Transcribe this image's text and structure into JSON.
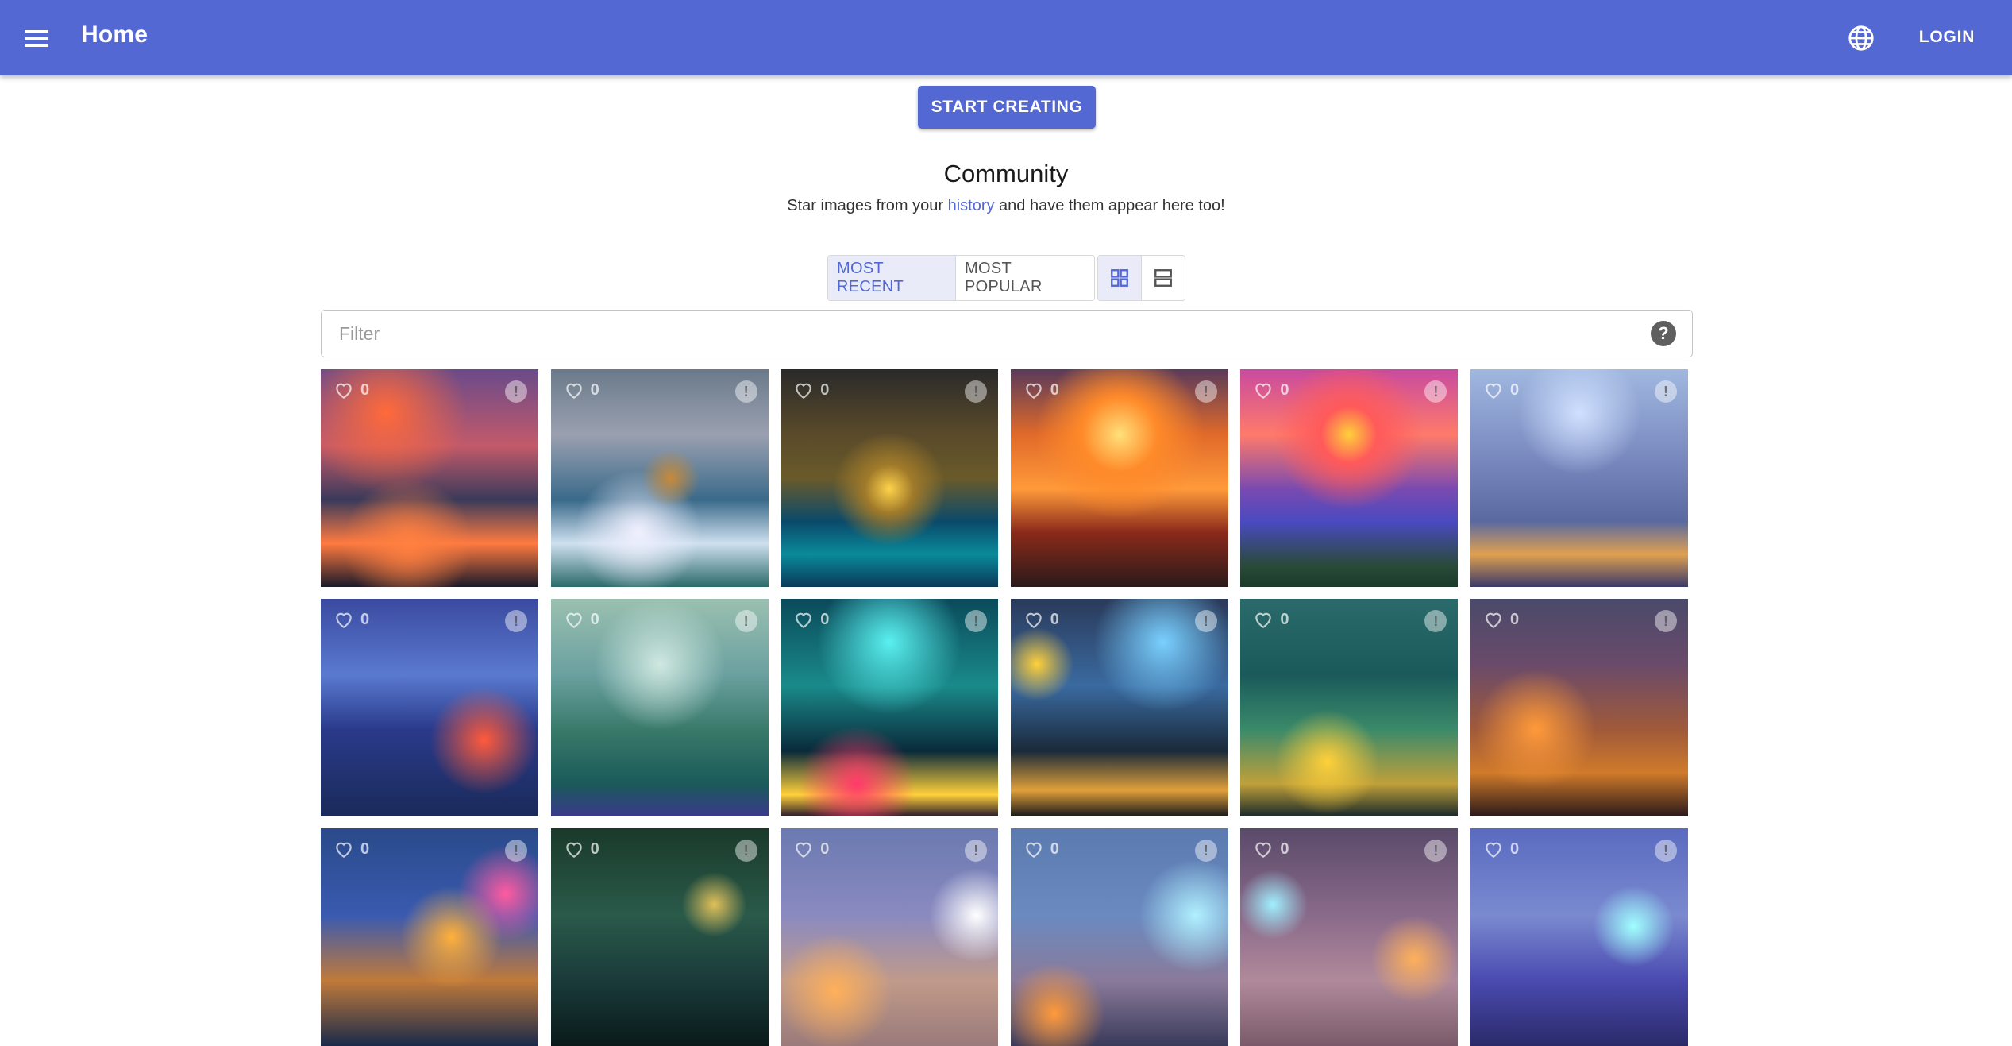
{
  "appbar": {
    "menu_icon": "hamburger-menu-icon",
    "title": "Home",
    "language_icon": "globe-icon",
    "login_label": "LOGIN"
  },
  "hero": {
    "start_label": "START CREATING"
  },
  "community": {
    "title": "Community",
    "subtitle_before": "Star images from your ",
    "subtitle_link": "history",
    "subtitle_after": " and have them appear here too!"
  },
  "sort": {
    "options": [
      "MOST RECENT",
      "MOST POPULAR"
    ],
    "selected": "MOST RECENT"
  },
  "view": {
    "grid_icon": "grid-view-icon",
    "list_icon": "list-view-icon",
    "selected": "grid"
  },
  "filter": {
    "placeholder": "Filter",
    "value": "",
    "help_icon": "help-icon",
    "help_label": "?"
  },
  "tiles": [
    {
      "likes": "0"
    },
    {
      "likes": "0"
    },
    {
      "likes": "0"
    },
    {
      "likes": "0"
    },
    {
      "likes": "0"
    },
    {
      "likes": "0"
    },
    {
      "likes": "0"
    },
    {
      "likes": "0"
    },
    {
      "likes": "0"
    },
    {
      "likes": "0"
    },
    {
      "likes": "0"
    },
    {
      "likes": "0"
    },
    {
      "likes": "0"
    },
    {
      "likes": "0"
    },
    {
      "likes": "0"
    },
    {
      "likes": "0"
    },
    {
      "likes": "0"
    },
    {
      "likes": "0"
    }
  ],
  "colors": {
    "primary": "#5468d4",
    "selected_bg": "#e9ecf8"
  }
}
